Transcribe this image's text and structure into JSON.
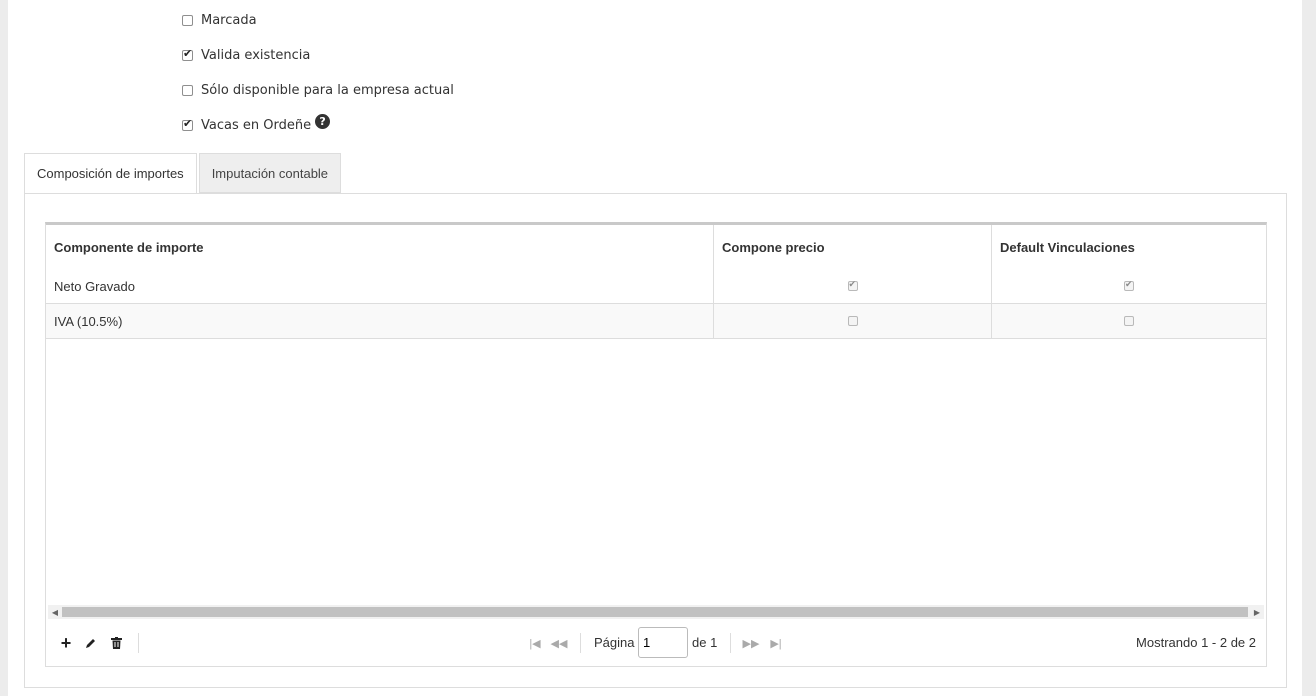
{
  "options": [
    {
      "label": "Marcada",
      "checked": false
    },
    {
      "label": "Valida existencia",
      "checked": true
    },
    {
      "label": "Sólo disponible para la empresa actual",
      "checked": false
    },
    {
      "label": "Vacas en Ordeñe",
      "checked": true,
      "help_icon": "question-circle-icon"
    }
  ],
  "tabs": [
    {
      "label": "Composición de importes",
      "active": true
    },
    {
      "label": "Imputación contable",
      "active": false
    }
  ],
  "grid": {
    "columns": [
      "Componente de importe",
      "Compone precio",
      "Default Vinculaciones"
    ],
    "rows": [
      {
        "name": "Neto Gravado",
        "compone_precio": true,
        "default_vinculaciones": true
      },
      {
        "name": "IVA (10.5%)",
        "compone_precio": false,
        "default_vinculaciones": false
      }
    ]
  },
  "toolbar": {
    "add_icon": "plus-icon",
    "edit_icon": "pencil-icon",
    "delete_icon": "trash-icon"
  },
  "pager": {
    "page_label": "Página",
    "page_value": "1",
    "of_label": "de 1",
    "showing": "Mostrando 1 - 2 de 2"
  }
}
